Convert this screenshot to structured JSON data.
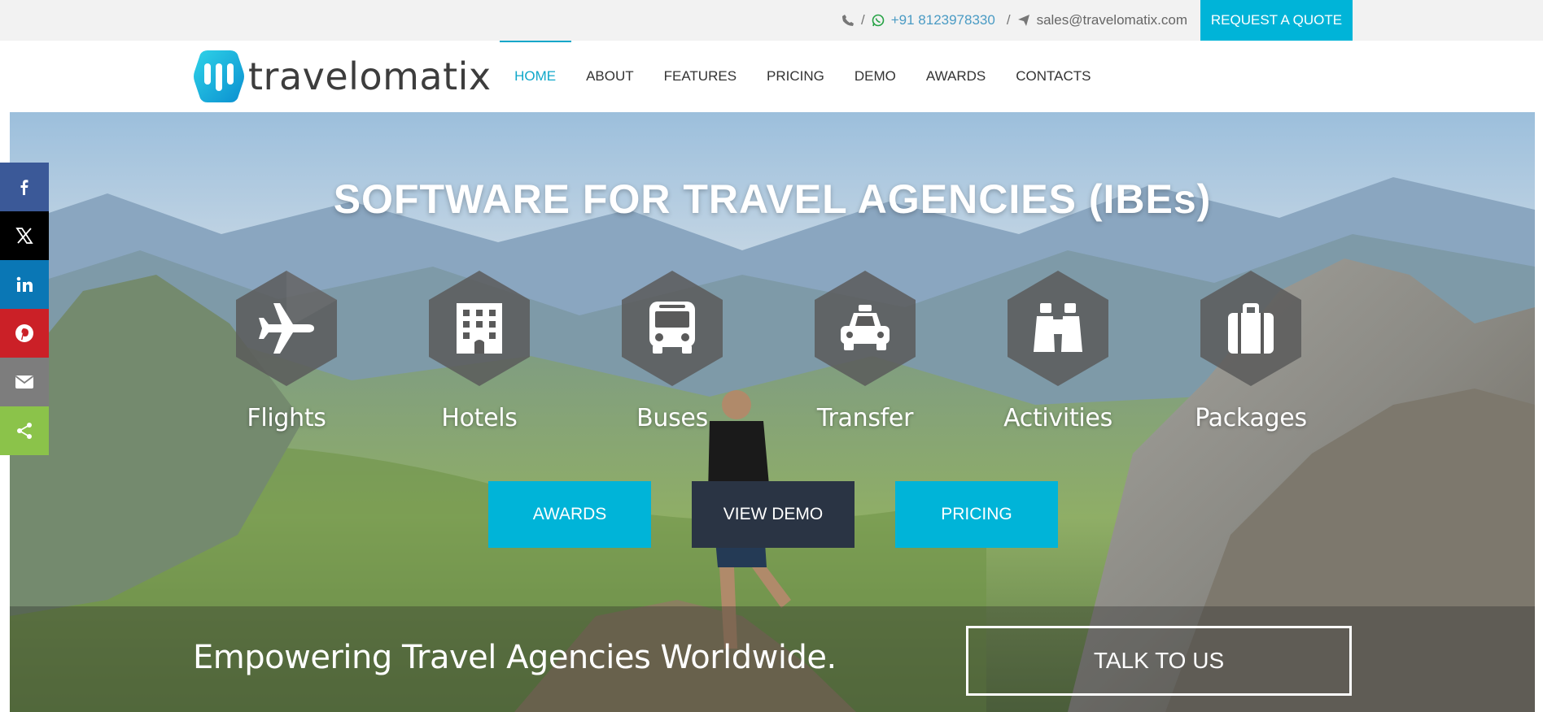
{
  "topbar": {
    "phone_separator": "/",
    "phone": "+91 8123978330",
    "email_separator": "/",
    "email": "sales@travelomatix.com",
    "quote_button": "REQUEST A QUOTE"
  },
  "header": {
    "logo_text": "travelomatix",
    "nav": [
      {
        "label": "HOME",
        "active": true
      },
      {
        "label": "ABOUT",
        "active": false
      },
      {
        "label": "FEATURES",
        "active": false
      },
      {
        "label": "PRICING",
        "active": false
      },
      {
        "label": "DEMO",
        "active": false
      },
      {
        "label": "AWARDS",
        "active": false
      },
      {
        "label": "CONTACTS",
        "active": false
      }
    ]
  },
  "hero": {
    "title": "SOFTWARE FOR TRAVEL AGENCIES (IBEs)",
    "services": [
      {
        "label": "Flights",
        "icon": "plane-icon"
      },
      {
        "label": "Hotels",
        "icon": "building-icon"
      },
      {
        "label": "Buses",
        "icon": "bus-icon"
      },
      {
        "label": "Transfer",
        "icon": "taxi-icon"
      },
      {
        "label": "Activities",
        "icon": "binoculars-icon"
      },
      {
        "label": "Packages",
        "icon": "suitcase-icon"
      }
    ],
    "buttons": {
      "awards": "AWARDS",
      "view_demo": "VIEW DEMO",
      "pricing": "PRICING"
    },
    "tagline": "Empowering Travel Agencies Worldwide.",
    "talk_button": "TALK TO US"
  },
  "share_bar": [
    {
      "network": "facebook",
      "icon": "facebook-icon",
      "color": "#3b5998"
    },
    {
      "network": "x",
      "icon": "x-icon",
      "color": "#000000"
    },
    {
      "network": "linkedin",
      "icon": "linkedin-icon",
      "color": "#0a77b5"
    },
    {
      "network": "pinterest",
      "icon": "pinterest-icon",
      "color": "#cb2027"
    },
    {
      "network": "email",
      "icon": "email-icon",
      "color": "#7d7d7d"
    },
    {
      "network": "share",
      "icon": "share-icon",
      "color": "#8bc34a"
    }
  ],
  "colors": {
    "accent": "#00b4d8",
    "dark_button": "#2a3444",
    "nav_active": "#0fa7c9"
  }
}
